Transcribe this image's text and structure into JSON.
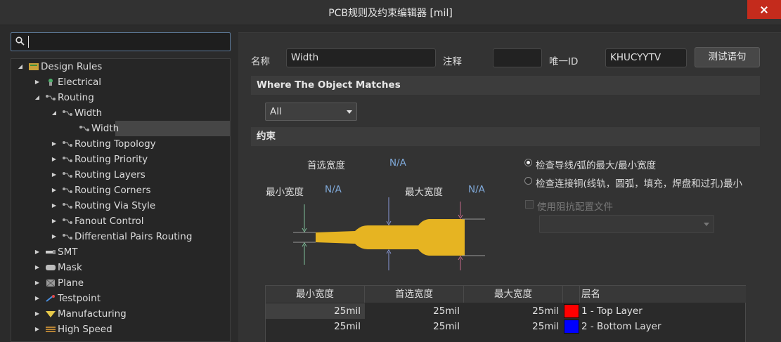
{
  "window": {
    "title": "PCB规则及约束编辑器 [mil]"
  },
  "search": {
    "value": ""
  },
  "tree": {
    "root": "Design Rules",
    "items": [
      {
        "label": "Design Rules",
        "level": 0,
        "expanded": true
      },
      {
        "label": "Electrical",
        "level": 1,
        "expanded": false
      },
      {
        "label": "Routing",
        "level": 1,
        "expanded": true
      },
      {
        "label": "Width",
        "level": 2,
        "expanded": true
      },
      {
        "label": "Width",
        "level": 3,
        "selected": true
      },
      {
        "label": "Routing Topology",
        "level": 2,
        "expanded": false
      },
      {
        "label": "Routing Priority",
        "level": 2,
        "expanded": false
      },
      {
        "label": "Routing Layers",
        "level": 2,
        "expanded": false
      },
      {
        "label": "Routing Corners",
        "level": 2,
        "expanded": false
      },
      {
        "label": "Routing Via Style",
        "level": 2,
        "expanded": false
      },
      {
        "label": "Fanout Control",
        "level": 2,
        "expanded": false
      },
      {
        "label": "Differential Pairs Routing",
        "level": 2,
        "expanded": false
      },
      {
        "label": "SMT",
        "level": 1,
        "expanded": false
      },
      {
        "label": "Mask",
        "level": 1,
        "expanded": false
      },
      {
        "label": "Plane",
        "level": 1,
        "expanded": false
      },
      {
        "label": "Testpoint",
        "level": 1,
        "expanded": false
      },
      {
        "label": "Manufacturing",
        "level": 1,
        "expanded": false
      },
      {
        "label": "High Speed",
        "level": 1,
        "expanded": false
      }
    ]
  },
  "rule": {
    "name_label": "名称",
    "name_value": "Width",
    "comment_label": "注释",
    "comment_value": "",
    "uid_label": "唯一ID",
    "uid_value": "KHUCYYTV",
    "test_button": "测试语句"
  },
  "where": {
    "header": "Where The Object Matches",
    "scope_value": "All"
  },
  "constraints": {
    "header": "约束",
    "preferred_label": "首选宽度",
    "preferred_value": "N/A",
    "min_label": "最小宽度",
    "min_value": "N/A",
    "max_label": "最大宽度",
    "max_value": "N/A",
    "option1": "检查导线/弧的最大/最小宽度",
    "option2": "检查连接铜(线轨，圆弧，填充，焊盘和过孔)最小",
    "impedance_label": "使用阻抗配置文件",
    "selected_option": 1
  },
  "table": {
    "headers": [
      "最小宽度",
      "首选宽度",
      "最大宽度",
      "",
      "层名"
    ],
    "rows": [
      {
        "min": "25mil",
        "pref": "25mil",
        "max": "25mil",
        "color": "#ff0000",
        "layer": "1 - Top Layer"
      },
      {
        "min": "25mil",
        "pref": "25mil",
        "max": "25mil",
        "color": "#0000ff",
        "layer": "2 - Bottom Layer"
      }
    ]
  },
  "colors": {
    "track": "#e6b422",
    "accent": "#7fa8d8"
  }
}
